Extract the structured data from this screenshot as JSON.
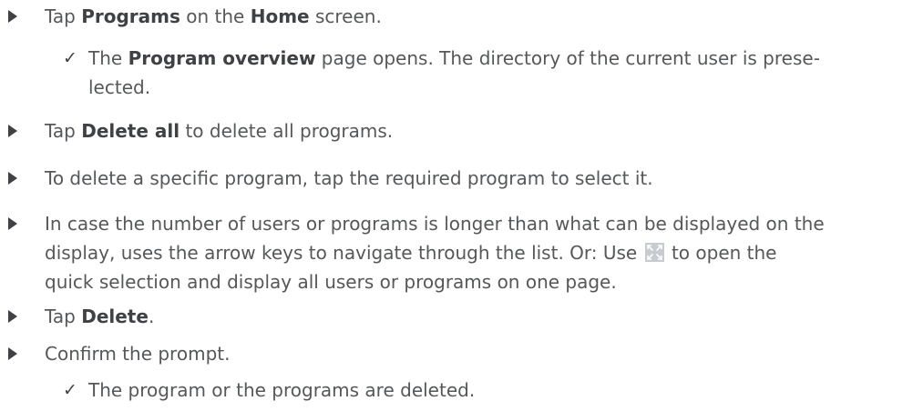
{
  "steps": [
    {
      "pre": "Tap ",
      "b1": "Programs",
      "mid": " on the ",
      "b2": "Home",
      "post": " screen."
    },
    {
      "result_pre": "The ",
      "result_b": "Program overview",
      "result_line1_post": " page opens. The directory of the current user is prese-",
      "result_line2": "lected."
    },
    {
      "pre": "Tap ",
      "b1": "Delete all",
      "post": " to delete all programs."
    },
    {
      "text": "To delete a specific program, tap the required program to select it."
    },
    {
      "line1": "In case the number of users or programs is longer than what can be displayed on the",
      "line2_pre": "display, uses the arrow keys to navigate through the list. Or: Use ",
      "line2_post": " to open the",
      "line3": "quick selection and display all users or programs on one page.",
      "icon": "expand-icon"
    },
    {
      "pre": "Tap ",
      "b1": "Delete",
      "post": "."
    },
    {
      "text": "Confirm the prompt."
    },
    {
      "result_text": "The program or the programs are deleted."
    }
  ],
  "colors": {
    "text": "#555759",
    "bullet": "#3f4144",
    "icon_bg": "#c8cbcf",
    "icon_arrow": "#ffffff"
  },
  "glyphs": {
    "check": "✓"
  }
}
